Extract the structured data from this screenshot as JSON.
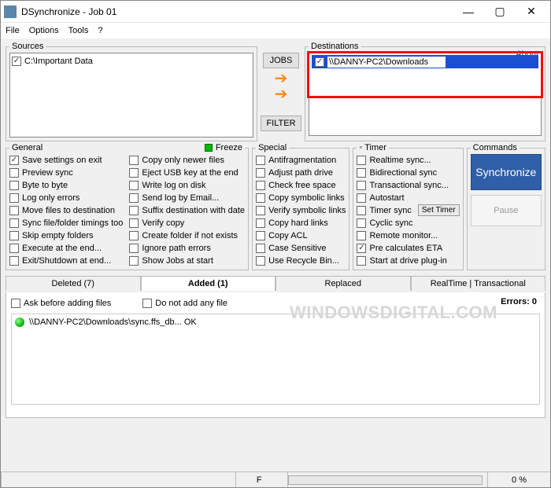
{
  "window": {
    "title": "DSynchronize - Job 01"
  },
  "menu": {
    "file": "File",
    "options": "Options",
    "tools": "Tools",
    "help": "?"
  },
  "sources": {
    "legend": "Sources",
    "items": [
      {
        "checked": true,
        "path": "C:\\Important Data"
      }
    ]
  },
  "mid": {
    "jobs": "JOBS",
    "filter": "FILTER"
  },
  "destinations": {
    "legend": "Destinations",
    "about": "About",
    "items": [
      {
        "checked": true,
        "path": "\\\\DANNY-PC2\\Downloads"
      }
    ]
  },
  "general": {
    "legend": "General",
    "freeze": "Freeze",
    "left": [
      {
        "c": true,
        "t": "Save settings on exit"
      },
      {
        "c": false,
        "t": "Preview sync"
      },
      {
        "c": false,
        "t": "Byte to byte"
      },
      {
        "c": false,
        "t": "Log only errors"
      },
      {
        "c": false,
        "t": "Move files to destination"
      },
      {
        "c": false,
        "t": "Sync file/folder timings too"
      },
      {
        "c": false,
        "t": "Skip empty folders"
      },
      {
        "c": false,
        "t": "Execute at the end..."
      },
      {
        "c": false,
        "t": "Exit/Shutdown at end..."
      }
    ],
    "right": [
      {
        "c": false,
        "t": "Copy only newer files"
      },
      {
        "c": false,
        "t": "Eject USB key at the end"
      },
      {
        "c": false,
        "t": "Write log on disk"
      },
      {
        "c": false,
        "t": "Send log by Email..."
      },
      {
        "c": false,
        "t": "Suffix destination with date"
      },
      {
        "c": false,
        "t": "Verify copy"
      },
      {
        "c": false,
        "t": "Create folder if not exists"
      },
      {
        "c": false,
        "t": "Ignore path errors"
      },
      {
        "c": false,
        "t": "Show Jobs at start"
      }
    ]
  },
  "special": {
    "legend": "Special",
    "items": [
      {
        "c": false,
        "t": "Antifragmentation"
      },
      {
        "c": false,
        "t": "Adjust path drive"
      },
      {
        "c": false,
        "t": "Check free space"
      },
      {
        "c": false,
        "t": "Copy symbolic links"
      },
      {
        "c": false,
        "t": "Verify symbolic links"
      },
      {
        "c": false,
        "t": "Copy hard links"
      },
      {
        "c": false,
        "t": "Copy ACL"
      },
      {
        "c": false,
        "t": "Case Sensitive"
      },
      {
        "c": false,
        "t": "Use Recycle Bin..."
      }
    ]
  },
  "timer": {
    "legend": "Timer",
    "settimer": "Set Timer",
    "items": [
      {
        "c": false,
        "t": "Realtime sync..."
      },
      {
        "c": false,
        "t": "Bidirectional sync"
      },
      {
        "c": false,
        "t": "Transactional sync..."
      },
      {
        "c": false,
        "t": "Autostart"
      },
      {
        "c": false,
        "t": "Timer sync",
        "hasBtn": true
      },
      {
        "c": false,
        "t": "Cyclic sync"
      },
      {
        "c": false,
        "t": "Remote monitor..."
      },
      {
        "c": true,
        "t": "Pre calculates ETA"
      },
      {
        "c": false,
        "t": "Start at drive plug-in"
      }
    ]
  },
  "commands": {
    "legend": "Commands",
    "sync": "Synchronize",
    "pause": "Pause"
  },
  "tabs": {
    "deleted": "Deleted (7)",
    "added": "Added (1)",
    "replaced": "Replaced",
    "realtime": "RealTime | Transactional",
    "askbefore": "Ask before adding files",
    "donotadd": "Do not add any file",
    "errors": "Errors: 0",
    "logline": "\\\\DANNY-PC2\\Downloads\\sync.ffs_db... OK"
  },
  "status": {
    "f": "F",
    "pct": "0 %"
  },
  "winbuttons": {
    "min": "—",
    "max": "▢",
    "close": "✕"
  },
  "watermark": "WINDOWSDIGITAL.COM"
}
